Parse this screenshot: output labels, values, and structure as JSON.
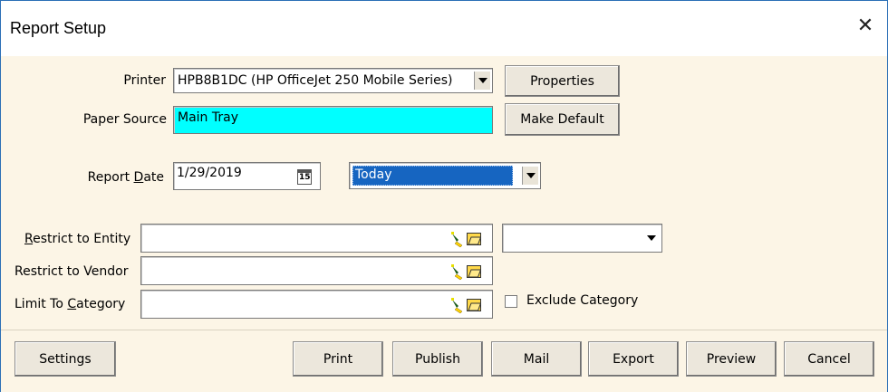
{
  "window": {
    "title": "Report Setup",
    "close_glyph": "✕"
  },
  "printer": {
    "label": "Printer",
    "value": "HPB8B1DC (HP OfficeJet 250 Mobile Series)",
    "properties_button": "Properties"
  },
  "paper_source": {
    "label": "Paper Source",
    "value": "Main Tray",
    "highlight_color": "#00ffff",
    "make_default_button": "Make Default"
  },
  "report_date": {
    "label_prefix": "Report ",
    "label_underlined": "D",
    "label_suffix": "ate",
    "value": "1/29/2019",
    "calendar_glyph": "15",
    "range_value": "Today",
    "range_color": "#1665c1"
  },
  "restrict_entity": {
    "label_underlined": "R",
    "label_suffix": "estrict to Entity",
    "value": "",
    "dropdown_value": ""
  },
  "restrict_vendor": {
    "label": "Restrict to Vendor",
    "value": ""
  },
  "limit_category": {
    "label_prefix": "Limit To ",
    "label_underlined": "C",
    "label_suffix": "ategory",
    "value": "",
    "exclude_label": "Exclude Category",
    "exclude_checked": false
  },
  "footer": {
    "settings": "Settings",
    "print": "Print",
    "publish": "Publish",
    "mail": "Mail",
    "export": "Export",
    "preview": "Preview",
    "cancel": "Cancel"
  },
  "icons": {
    "pen": "pen-icon",
    "folder": "folder-open-icon",
    "calendar": "calendar-icon",
    "dropdown": "chevron-down-icon",
    "close": "close-icon"
  }
}
